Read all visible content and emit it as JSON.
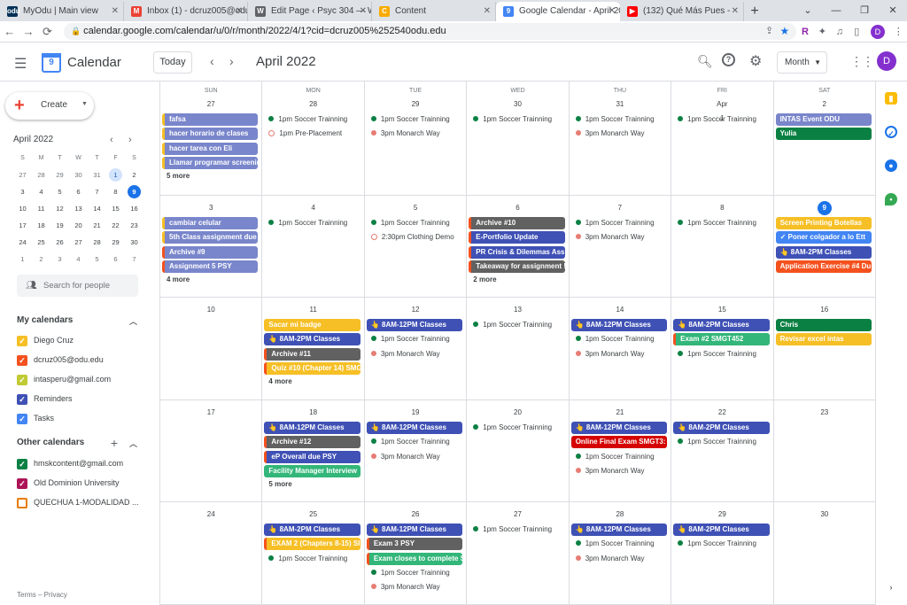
{
  "browser": {
    "tabs": [
      {
        "title": "MyOdu | Main view",
        "icon": "odu-icon",
        "icon_color": "#003057",
        "icon_text": "odu"
      },
      {
        "title": "Inbox (1) - dcruz005@odu.e",
        "icon": "gmail-icon",
        "icon_color": "#ea4335",
        "icon_text": "M"
      },
      {
        "title": "Edit Page ‹ Psyc 304 — W",
        "icon": "wordpress-icon",
        "icon_color": "#5f6368",
        "icon_text": "W"
      },
      {
        "title": "Content",
        "icon": "content-icon",
        "icon_color": "#f9ab00",
        "icon_text": "C"
      },
      {
        "title": "Google Calendar - April 20",
        "icon": "calendar-icon",
        "icon_color": "#4285f4",
        "icon_text": "9",
        "active": true
      },
      {
        "title": "(132) Qué Más Pues -",
        "icon": "youtube-icon",
        "icon_color": "#ff0000",
        "icon_text": "▶"
      }
    ],
    "url": "calendar.google.com/calendar/u/0/r/month/2022/4/1?cid=dcruz005%252540odu.edu",
    "profile_initial": "D"
  },
  "app": {
    "title": "Calendar",
    "logo_day": "9",
    "today_label": "Today",
    "current_month": "April 2022",
    "view_label": "Month",
    "user_initial": "D"
  },
  "sidebar": {
    "create_label": "Create",
    "mini_month": "April 2022",
    "mini_headers": [
      "S",
      "M",
      "T",
      "W",
      "T",
      "F",
      "S"
    ],
    "mini_days": [
      "27",
      "28",
      "29",
      "30",
      "31",
      "1",
      "2",
      "3",
      "4",
      "5",
      "6",
      "7",
      "8",
      "9",
      "10",
      "11",
      "12",
      "13",
      "14",
      "15",
      "16",
      "17",
      "18",
      "19",
      "20",
      "21",
      "22",
      "23",
      "24",
      "25",
      "26",
      "27",
      "28",
      "29",
      "30",
      "1",
      "2",
      "3",
      "4",
      "5",
      "6",
      "7"
    ],
    "search_people": "Search for people",
    "my_calendars_label": "My calendars",
    "my_calendars": [
      {
        "name": "Diego Cruz",
        "color": "#f6bf26"
      },
      {
        "name": "dcruz005@odu.edu",
        "color": "#f4511e"
      },
      {
        "name": "intasperu@gmail.com",
        "color": "#c0ca33"
      },
      {
        "name": "Reminders",
        "color": "#3f51b5"
      },
      {
        "name": "Tasks",
        "color": "#4285f4"
      }
    ],
    "other_calendars_label": "Other calendars",
    "other_calendars": [
      {
        "name": "hmskcontent@gmail.com",
        "color": "#0b8043",
        "checked": true
      },
      {
        "name": "Old Dominion University",
        "color": "#ad1457",
        "checked": true
      },
      {
        "name": "QUECHUA 1-MODALIDAD ...",
        "color": "#e67c00",
        "checked": false
      }
    ],
    "footer": "Terms – Privacy"
  },
  "calendar": {
    "weekdays": [
      "SUN",
      "MON",
      "TUE",
      "WED",
      "THU",
      "FRI",
      "SAT"
    ],
    "weeks": [
      [
        {
          "day": "27",
          "events": [
            {
              "type": "bar",
              "text": "fafsa",
              "color": "#7986cb",
              "stripe": "#f6bf26"
            },
            {
              "type": "bar",
              "text": "hacer horario de clases",
              "color": "#7986cb",
              "stripe": "#f6bf26"
            },
            {
              "type": "bar",
              "text": "hacer tarea con Eli",
              "color": "#7986cb",
              "stripe": "#f6bf26"
            },
            {
              "type": "bar",
              "text": "Llamar programar screening",
              "color": "#7986cb",
              "stripe": "#f6bf26"
            }
          ],
          "more": "5 more"
        },
        {
          "day": "28",
          "events": [
            {
              "type": "dot",
              "text": "1pm Soccer Trainning",
              "color": "#0b8043"
            },
            {
              "type": "ring",
              "text": "1pm Pre-Placement",
              "color": "#e67c73"
            }
          ]
        },
        {
          "day": "29",
          "events": [
            {
              "type": "dot",
              "text": "1pm Soccer Trainning",
              "color": "#0b8043"
            },
            {
              "type": "dot",
              "text": "3pm Monarch Way",
              "color": "#e67c73"
            }
          ]
        },
        {
          "day": "30",
          "events": [
            {
              "type": "dot",
              "text": "1pm Soccer Trainning",
              "color": "#0b8043"
            }
          ]
        },
        {
          "day": "31",
          "events": [
            {
              "type": "dot",
              "text": "1pm Soccer Trainning",
              "color": "#0b8043"
            },
            {
              "type": "dot",
              "text": "3pm Monarch Way",
              "color": "#e67c73"
            }
          ]
        },
        {
          "day": "Apr 1",
          "events": [
            {
              "type": "dot",
              "text": "1pm Soccer Trainning",
              "color": "#0b8043"
            }
          ]
        },
        {
          "day": "2",
          "events": [
            {
              "type": "bar",
              "text": "INTAS Event ODU",
              "color": "#7986cb"
            },
            {
              "type": "bar",
              "text": "Yulia",
              "color": "#0b8043"
            }
          ]
        }
      ],
      [
        {
          "day": "3",
          "events": [
            {
              "type": "bar",
              "text": "cambiar celular",
              "color": "#7986cb",
              "stripe": "#f6bf26"
            },
            {
              "type": "bar",
              "text": "5th Class assignment due",
              "color": "#7986cb",
              "stripe": "#f6bf26"
            },
            {
              "type": "bar",
              "text": "Archive #9",
              "color": "#7986cb",
              "stripe": "#f4511e"
            },
            {
              "type": "bar",
              "text": "Assignment 5 PSY",
              "color": "#7986cb",
              "stripe": "#f4511e"
            }
          ],
          "more": "4 more"
        },
        {
          "day": "4",
          "events": [
            {
              "type": "dot",
              "text": "1pm Soccer Trainning",
              "color": "#0b8043"
            }
          ]
        },
        {
          "day": "5",
          "events": [
            {
              "type": "dot",
              "text": "1pm Soccer Trainning",
              "color": "#0b8043"
            },
            {
              "type": "ring",
              "text": "2:30pm Clothing Demo",
              "color": "#e67c73"
            }
          ]
        },
        {
          "day": "6",
          "events": [
            {
              "type": "bar",
              "text": "Archive #10",
              "color": "#616161",
              "stripe": "#f4511e"
            },
            {
              "type": "bar",
              "text": "E-Portfolio Update",
              "color": "#3f51b5",
              "stripe": "#f4511e"
            },
            {
              "type": "bar",
              "text": "PR Crisis & Dilemmas Assi",
              "color": "#3f51b5",
              "stripe": "#f4511e"
            },
            {
              "type": "bar",
              "text": "Takeaway for assignment !",
              "color": "#616161",
              "stripe": "#f4511e"
            }
          ],
          "more": "2 more"
        },
        {
          "day": "7",
          "events": [
            {
              "type": "dot",
              "text": "1pm Soccer Trainning",
              "color": "#0b8043"
            },
            {
              "type": "dot",
              "text": "3pm Monarch Way",
              "color": "#e67c73"
            }
          ]
        },
        {
          "day": "8",
          "events": [
            {
              "type": "dot",
              "text": "1pm Soccer Trainning",
              "color": "#0b8043"
            }
          ]
        },
        {
          "day": "9",
          "today": true,
          "events": [
            {
              "type": "bar",
              "text": "Screen Printing Botellas",
              "color": "#f6bf26"
            },
            {
              "type": "bar",
              "text": "✓ Poner colgador a lo Ett",
              "color": "#4285f4"
            },
            {
              "type": "bar",
              "text": "👆 8AM-2PM Classes",
              "color": "#3f51b5"
            },
            {
              "type": "bar",
              "text": "Application Exercise #4 Du",
              "color": "#f4511e"
            }
          ]
        }
      ],
      [
        {
          "day": "10",
          "events": []
        },
        {
          "day": "11",
          "events": [
            {
              "type": "bar",
              "text": "Sacar mi badge",
              "color": "#f6bf26"
            },
            {
              "type": "bar",
              "text": "👆 8AM-2PM Classes",
              "color": "#3f51b5"
            },
            {
              "type": "bar",
              "text": "Archive #11",
              "color": "#616161",
              "stripe": "#f4511e"
            },
            {
              "type": "bar",
              "text": "Quiz #10 (Chapter 14) SMG",
              "color": "#f6bf26",
              "stripe": "#f4511e"
            }
          ],
          "more": "4 more"
        },
        {
          "day": "12",
          "events": [
            {
              "type": "bar",
              "text": "👆 8AM-12PM Classes",
              "color": "#3f51b5"
            },
            {
              "type": "dot",
              "text": "1pm Soccer Trainning",
              "color": "#0b8043"
            },
            {
              "type": "dot",
              "text": "3pm Monarch Way",
              "color": "#e67c73"
            }
          ]
        },
        {
          "day": "13",
          "events": [
            {
              "type": "dot",
              "text": "1pm Soccer Trainning",
              "color": "#0b8043"
            }
          ]
        },
        {
          "day": "14",
          "events": [
            {
              "type": "bar",
              "text": "👆 8AM-12PM Classes",
              "color": "#3f51b5"
            },
            {
              "type": "dot",
              "text": "1pm Soccer Trainning",
              "color": "#0b8043"
            },
            {
              "type": "dot",
              "text": "3pm Monarch Way",
              "color": "#e67c73"
            }
          ]
        },
        {
          "day": "15",
          "events": [
            {
              "type": "bar",
              "text": "👆 8AM-2PM Classes",
              "color": "#3f51b5"
            },
            {
              "type": "bar",
              "text": "Exam #2 SMGT452",
              "color": "#33b679",
              "stripe": "#f4511e"
            },
            {
              "type": "dot",
              "text": "1pm Soccer Trainning",
              "color": "#0b8043"
            }
          ]
        },
        {
          "day": "16",
          "events": [
            {
              "type": "bar",
              "text": "Chris",
              "color": "#0b8043"
            },
            {
              "type": "bar",
              "text": "Revisar excel intas",
              "color": "#f6bf26"
            }
          ]
        }
      ],
      [
        {
          "day": "17",
          "events": []
        },
        {
          "day": "18",
          "events": [
            {
              "type": "bar",
              "text": "👆 8AM-12PM Classes",
              "color": "#3f51b5"
            },
            {
              "type": "bar",
              "text": "Archive #12",
              "color": "#616161",
              "stripe": "#f4511e"
            },
            {
              "type": "bar",
              "text": "eP Overall due PSY",
              "color": "#3f51b5",
              "stripe": "#f4511e"
            },
            {
              "type": "bar",
              "text": "Facility Manager Interview",
              "color": "#33b679"
            }
          ],
          "more": "5 more"
        },
        {
          "day": "19",
          "events": [
            {
              "type": "bar",
              "text": "👆 8AM-12PM Classes",
              "color": "#3f51b5"
            },
            {
              "type": "dot",
              "text": "1pm Soccer Trainning",
              "color": "#0b8043"
            },
            {
              "type": "dot",
              "text": "3pm Monarch Way",
              "color": "#e67c73"
            }
          ]
        },
        {
          "day": "20",
          "events": [
            {
              "type": "dot",
              "text": "1pm Soccer Trainning",
              "color": "#0b8043"
            }
          ]
        },
        {
          "day": "21",
          "events": [
            {
              "type": "bar",
              "text": "👆 8AM-12PM Classes",
              "color": "#3f51b5"
            },
            {
              "type": "bar",
              "text": "Online Final Exam SMGT3:",
              "color": "#d50000"
            },
            {
              "type": "dot",
              "text": "1pm Soccer Trainning",
              "color": "#0b8043"
            },
            {
              "type": "dot",
              "text": "3pm Monarch Way",
              "color": "#e67c73"
            }
          ]
        },
        {
          "day": "22",
          "events": [
            {
              "type": "bar",
              "text": "👆 8AM-2PM Classes",
              "color": "#3f51b5"
            },
            {
              "type": "dot",
              "text": "1pm Soccer Trainning",
              "color": "#0b8043"
            }
          ]
        },
        {
          "day": "23",
          "events": []
        }
      ],
      [
        {
          "day": "24",
          "events": []
        },
        {
          "day": "25",
          "events": [
            {
              "type": "bar",
              "text": "👆 8AM-2PM Classes",
              "color": "#3f51b5"
            },
            {
              "type": "bar",
              "text": "EXAM 2 (Chapters 8-15) SI",
              "color": "#f6bf26",
              "stripe": "#f4511e"
            },
            {
              "type": "dot",
              "text": "1pm Soccer Trainning",
              "color": "#0b8043"
            }
          ]
        },
        {
          "day": "26",
          "events": [
            {
              "type": "bar",
              "text": "👆 8AM-12PM Classes",
              "color": "#3f51b5"
            },
            {
              "type": "bar",
              "text": "Exam 3 PSY",
              "color": "#616161",
              "stripe": "#f4511e"
            },
            {
              "type": "bar",
              "text": "Exam closes to complete S",
              "color": "#33b679",
              "stripe": "#f4511e"
            },
            {
              "type": "dot",
              "text": "1pm Soccer Trainning",
              "color": "#0b8043"
            },
            {
              "type": "dot",
              "text": "3pm Monarch Way",
              "color": "#e67c73"
            }
          ]
        },
        {
          "day": "27",
          "events": [
            {
              "type": "dot",
              "text": "1pm Soccer Trainning",
              "color": "#0b8043"
            }
          ]
        },
        {
          "day": "28",
          "events": [
            {
              "type": "bar",
              "text": "👆 8AM-12PM Classes",
              "color": "#3f51b5"
            },
            {
              "type": "dot",
              "text": "1pm Soccer Trainning",
              "color": "#0b8043"
            },
            {
              "type": "dot",
              "text": "3pm Monarch Way",
              "color": "#e67c73"
            }
          ]
        },
        {
          "day": "29",
          "events": [
            {
              "type": "bar",
              "text": "👆 8AM-2PM Classes",
              "color": "#3f51b5"
            },
            {
              "type": "dot",
              "text": "1pm Soccer Trainning",
              "color": "#0b8043"
            }
          ]
        },
        {
          "day": "30",
          "events": []
        }
      ]
    ]
  }
}
